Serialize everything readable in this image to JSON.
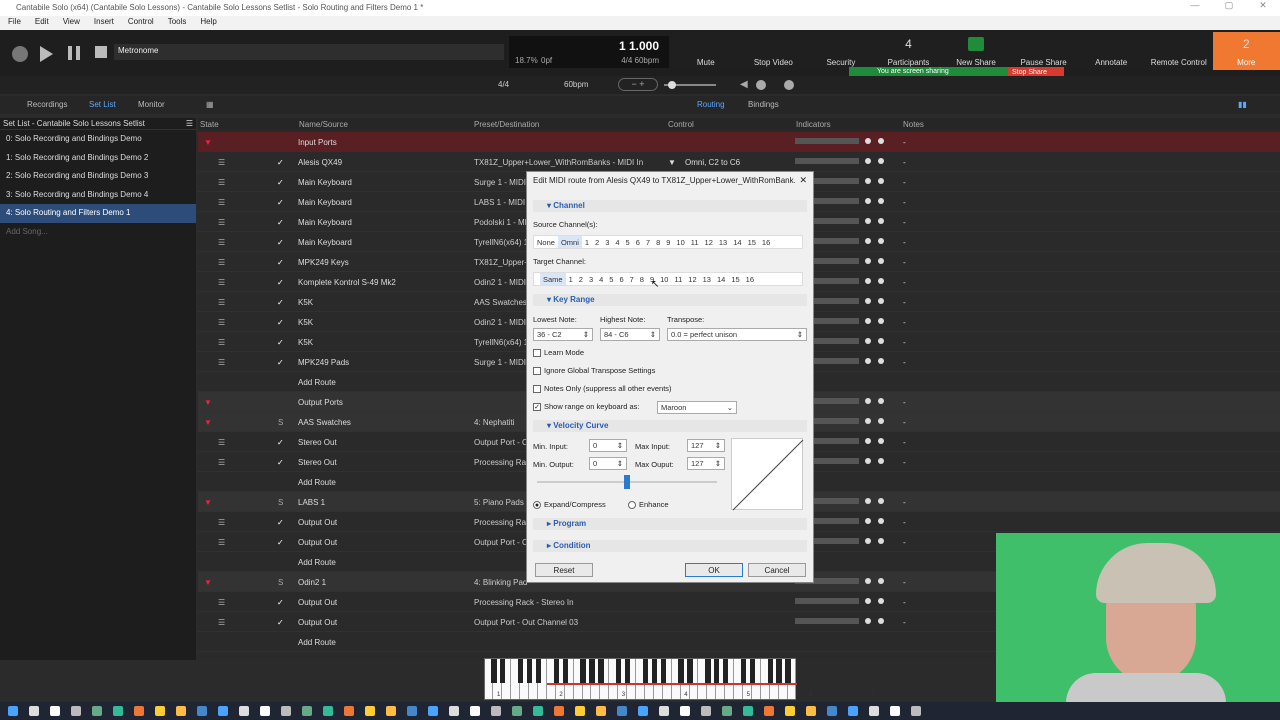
{
  "window": {
    "title": "Cantabile Solo (x64) (Cantabile Solo Lessons) - Cantabile Solo Lessons Setlist - Solo Routing and Filters Demo 1 *"
  },
  "menu": [
    "File",
    "Edit",
    "View",
    "Insert",
    "Control",
    "Tools",
    "Help"
  ],
  "toolbar": {
    "metronome_label": "Metronome",
    "position": "1 1.000",
    "cpu": "18.7%",
    "pdf": "0pf",
    "timesig_tempo": "4/4 60bpm",
    "timesig": "4/4",
    "bpm": "60bpm"
  },
  "zoom": {
    "buttons": [
      {
        "label": "Mute",
        "icon": "mic-icon"
      },
      {
        "label": "Stop Video",
        "icon": "camera-icon"
      },
      {
        "label": "Security",
        "icon": "shield-icon"
      },
      {
        "label": "Participants",
        "icon": "people-icon",
        "badge": "4"
      },
      {
        "label": "New Share",
        "icon": "share-icon"
      },
      {
        "label": "Pause Share",
        "icon": "pause-icon"
      },
      {
        "label": "Annotate",
        "icon": "pen-icon"
      },
      {
        "label": "Remote Control",
        "icon": "mouse-icon"
      },
      {
        "label": "More",
        "icon": "more-icon",
        "badge": "2"
      }
    ],
    "sharing_text": "You are screen sharing",
    "stop_share": "Stop Share"
  },
  "tabs": {
    "left": [
      "Recordings",
      "Set List",
      "Monitor"
    ],
    "right": [
      "Routing",
      "Bindings"
    ]
  },
  "setlist": {
    "header": "Set List - Cantabile Solo Lessons Setlist",
    "songs": [
      "0: Solo Recording and Bindings Demo",
      "1: Solo Recording and Bindings Demo 2",
      "2: Solo Recording and Bindings Demo 3",
      "3: Solo Recording and Bindings Demo 4",
      "4: Solo Routing and Filters Demo 1"
    ],
    "add": "Add Song..."
  },
  "columns": [
    "State",
    "Name/Source",
    "Preset/Destination",
    "Control",
    "Indicators",
    "Notes"
  ],
  "rows": [
    {
      "name": "Input Ports",
      "dest": "",
      "type": "input"
    },
    {
      "name": "Alesis QX49",
      "dest": "TX81Z_Upper+Lower_WithRomBanks - MIDI In",
      "ctrl": "Omni, C2 to C6",
      "check": true
    },
    {
      "name": "Main Keyboard",
      "dest": "Surge 1 - MIDI",
      "check": true
    },
    {
      "name": "Main Keyboard",
      "dest": "LABS 1 - MIDI",
      "check": true
    },
    {
      "name": "Main Keyboard",
      "dest": "Podolski 1 - MI",
      "check": true
    },
    {
      "name": "Main Keyboard",
      "dest": "TyrellN6(x64) 1",
      "check": true
    },
    {
      "name": "MPK249 Keys",
      "dest": "TX81Z_Upper+",
      "check": true
    },
    {
      "name": "Komplete Kontrol S-49 Mk2",
      "dest": "Odin2 1 - MIDI",
      "check": true
    },
    {
      "name": "K5K",
      "dest": "AAS Swatches",
      "check": true
    },
    {
      "name": "K5K",
      "dest": "Odin2 1 - MIDI",
      "check": true
    },
    {
      "name": "K5K",
      "dest": "TyrellN6(x64) 1",
      "check": true
    },
    {
      "name": "MPK249 Pads",
      "dest": "Surge 1 - MIDI",
      "check": true
    },
    {
      "name": "Add Route",
      "dest": "",
      "type": "add"
    },
    {
      "name": "Output Ports",
      "dest": "",
      "type": "rack"
    },
    {
      "name": "AAS Swatches",
      "dest": "4: Nephatiti",
      "type": "rack",
      "s": "S"
    },
    {
      "name": "Stereo Out",
      "dest": "Output Port - O",
      "check": true
    },
    {
      "name": "Stereo Out",
      "dest": "Processing Rack",
      "check": true
    },
    {
      "name": "Add Route",
      "dest": "",
      "type": "add"
    },
    {
      "name": "LABS 1",
      "dest": "5: Piano Pads L",
      "type": "rack",
      "s": "S"
    },
    {
      "name": "Output Out",
      "dest": "Processing Rack",
      "check": true
    },
    {
      "name": "Output Out",
      "dest": "Output Port - O",
      "check": true
    },
    {
      "name": "Add Route",
      "dest": "",
      "type": "add"
    },
    {
      "name": "Odin2 1",
      "dest": "4: Blinking Pad",
      "type": "rack",
      "s": "S"
    },
    {
      "name": "Output Out",
      "dest": "Processing Rack - Stereo In",
      "check": true
    },
    {
      "name": "Output Out",
      "dest": "Output Port - Out Channel 03",
      "check": true
    },
    {
      "name": "Add Route",
      "dest": "",
      "type": "add"
    }
  ],
  "dialog": {
    "title": "Edit MIDI route from Alesis QX49 to TX81Z_Upper+Lower_WithRomBank...",
    "channel": "Channel",
    "source_label": "Source Channel(s):",
    "source_opts": [
      "None",
      "Omni",
      "1",
      "2",
      "3",
      "4",
      "5",
      "6",
      "7",
      "8",
      "9",
      "10",
      "11",
      "12",
      "13",
      "14",
      "15",
      "16"
    ],
    "target_label": "Target Channel:",
    "target_opts": [
      "",
      "Same",
      "1",
      "2",
      "3",
      "4",
      "5",
      "6",
      "7",
      "8",
      "9",
      "10",
      "11",
      "12",
      "13",
      "14",
      "15",
      "16"
    ],
    "keyrange": "Key Range",
    "lowest_label": "Lowest Note:",
    "lowest": "36 - C2",
    "highest_label": "Highest Note:",
    "highest": "84 - C6",
    "transpose_label": "Transpose:",
    "transpose": "0.0 = perfect unison",
    "learn": "Learn Mode",
    "ignore": "Ignore Global Transpose Settings",
    "notes_only": "Notes Only (suppress all other events)",
    "show_range": "Show range on keyboard as:",
    "color": "Maroon",
    "velocity": "Velocity Curve",
    "min_input_label": "Min. Input:",
    "min_input": "0",
    "max_input_label": "Max Input:",
    "max_input": "127",
    "min_output_label": "Min. Output:",
    "min_output": "0",
    "max_output_label": "Max Ouput:",
    "max_output": "127",
    "expand": "Expand/Compress",
    "enhance": "Enhance",
    "program": "Program",
    "condition": "Condition",
    "reset": "Reset",
    "ok": "OK",
    "cancel": "Cancel"
  },
  "piano_octaves": [
    "1",
    "2",
    "3",
    "4",
    "5",
    "6",
    "7"
  ]
}
